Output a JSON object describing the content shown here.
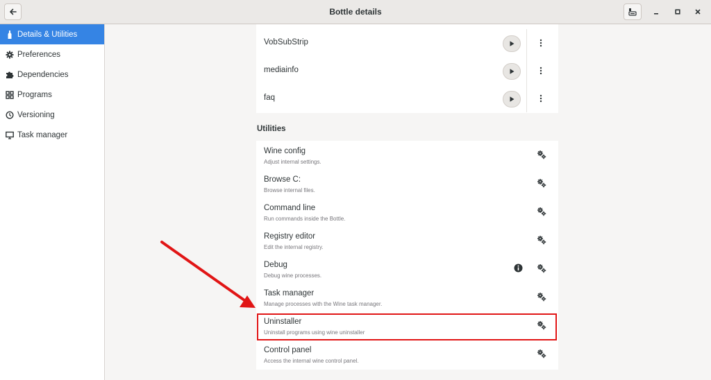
{
  "window": {
    "title": "Bottle details"
  },
  "sidebar": {
    "items": [
      {
        "label": "Details & Utilities",
        "icon": "bottle-icon",
        "active": true
      },
      {
        "label": "Preferences",
        "icon": "gear-icon",
        "active": false
      },
      {
        "label": "Dependencies",
        "icon": "puzzle-icon",
        "active": false
      },
      {
        "label": "Programs",
        "icon": "grid-icon",
        "active": false
      },
      {
        "label": "Versioning",
        "icon": "clock-icon",
        "active": false
      },
      {
        "label": "Task manager",
        "icon": "monitor-icon",
        "active": false
      }
    ]
  },
  "programs": [
    {
      "name": "VobSubStrip"
    },
    {
      "name": "mediainfo"
    },
    {
      "name": "faq"
    }
  ],
  "utilities": {
    "title": "Utilities",
    "items": [
      {
        "name": "Wine config",
        "description": "Adjust internal settings."
      },
      {
        "name": "Browse C:",
        "description": "Browse internal files."
      },
      {
        "name": "Command line",
        "description": "Run commands inside the Bottle."
      },
      {
        "name": "Registry editor",
        "description": "Edit the internal registry."
      },
      {
        "name": "Debug",
        "description": "Debug wine processes."
      },
      {
        "name": "Task manager",
        "description": "Manage processes with the Wine task manager."
      },
      {
        "name": "Uninstaller",
        "description": "Uninstall programs using wine uninstaller"
      },
      {
        "name": "Control panel",
        "description": "Access the internal wine control panel."
      }
    ]
  },
  "colors": {
    "accent": "#3584e4",
    "annotation": "#e11515"
  }
}
